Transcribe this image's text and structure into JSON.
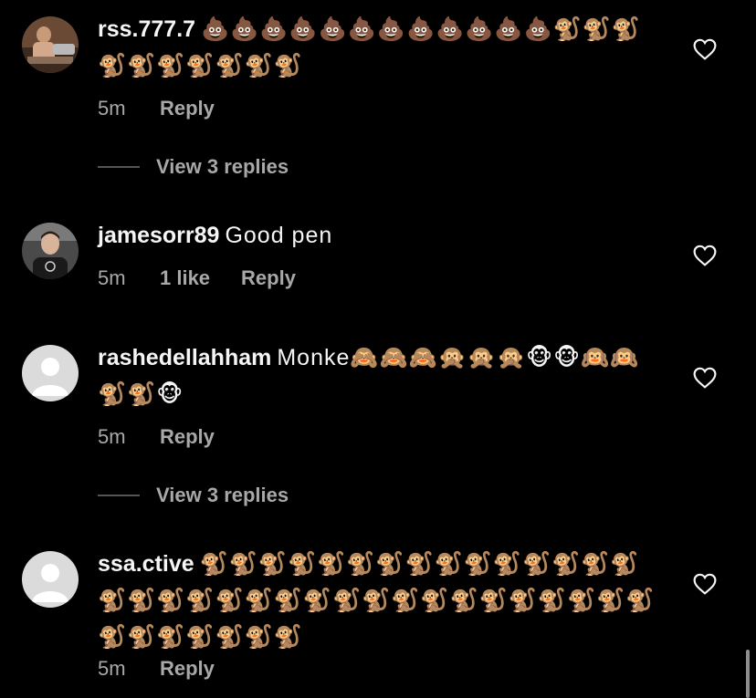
{
  "comments": [
    {
      "username": "rss.777.7",
      "text": "💩💩💩💩💩💩💩💩💩💩💩💩🐒🐒🐒🐒🐒🐒🐒🐒🐒🐒",
      "time": "5m",
      "likes": "",
      "reply_label": "Reply",
      "view_replies": "View 3 replies"
    },
    {
      "username": "jamesorr89",
      "text": "Good pen",
      "time": "5m",
      "likes": "1 like",
      "reply_label": "Reply",
      "view_replies": ""
    },
    {
      "username": "rashedellahham",
      "text": "Monke🙈🙈🙈🙊🙊🙊🐵🐵🙉🙉🐒🐒🐵",
      "time": "5m",
      "likes": "",
      "reply_label": "Reply",
      "view_replies": "View 3 replies"
    },
    {
      "username": "ssa.ctive",
      "text": "🐒🐒🐒🐒🐒🐒🐒🐒🐒🐒🐒🐒🐒🐒🐒🐒🐒🐒🐒🐒🐒🐒🐒🐒🐒🐒🐒🐒🐒🐒🐒🐒🐒🐒🐒🐒🐒🐒🐒🐒🐒",
      "time": "5m",
      "likes": "",
      "reply_label": "Reply",
      "view_replies": ""
    }
  ],
  "icons": {
    "like": "heart-outline-icon",
    "default_avatar": "person-placeholder-icon"
  },
  "colors": {
    "background": "#000000",
    "primary_text": "#f5f5f5",
    "secondary_text": "#a8a8a8"
  }
}
